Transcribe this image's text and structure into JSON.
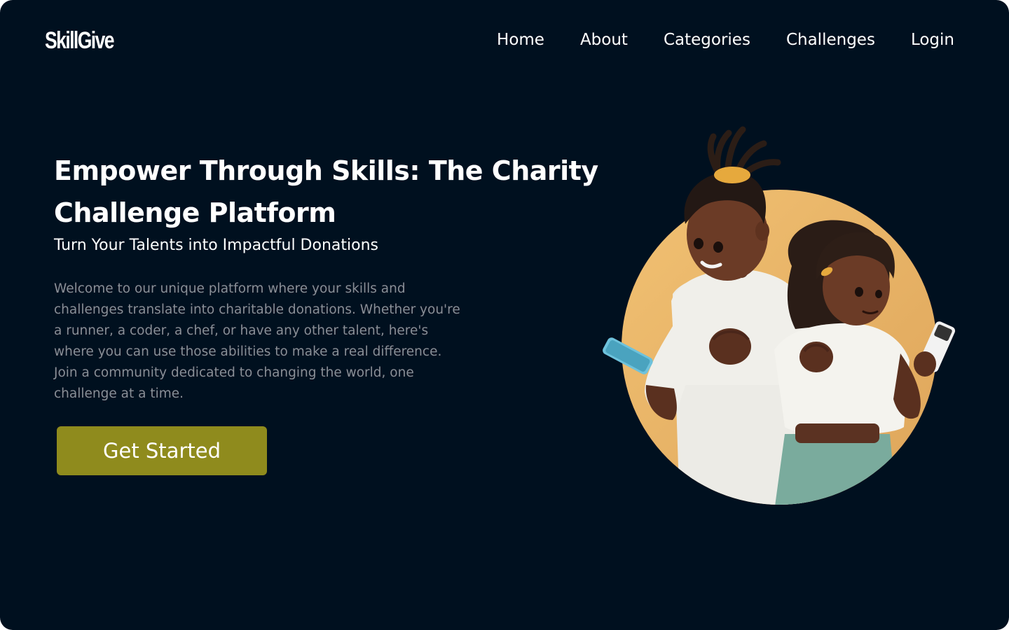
{
  "brand": {
    "logo": "SkillGive"
  },
  "nav": {
    "items": [
      "Home",
      "About",
      "Categories",
      "Challenges",
      "Login"
    ]
  },
  "hero": {
    "title": "Empower Through Skills: The Charity Challenge Platform",
    "subtitle": "Turn Your Talents into Impactful Donations",
    "description": "Welcome to our unique platform where your skills and challenges translate into charitable donations. Whether you're a runner, a coder, a chef, or have any other talent, here's where you can use those abilities to make a real difference. Join a community dedicated to changing the world, one challenge at a time.",
    "cta_label": "Get Started"
  },
  "colors": {
    "background": "#00101f",
    "text": "#ffffff",
    "muted_text": "#8a8e96",
    "button": "#8f8b1d",
    "illustration_circle": "#edb865"
  },
  "icons": [
    "hero-illustration"
  ]
}
